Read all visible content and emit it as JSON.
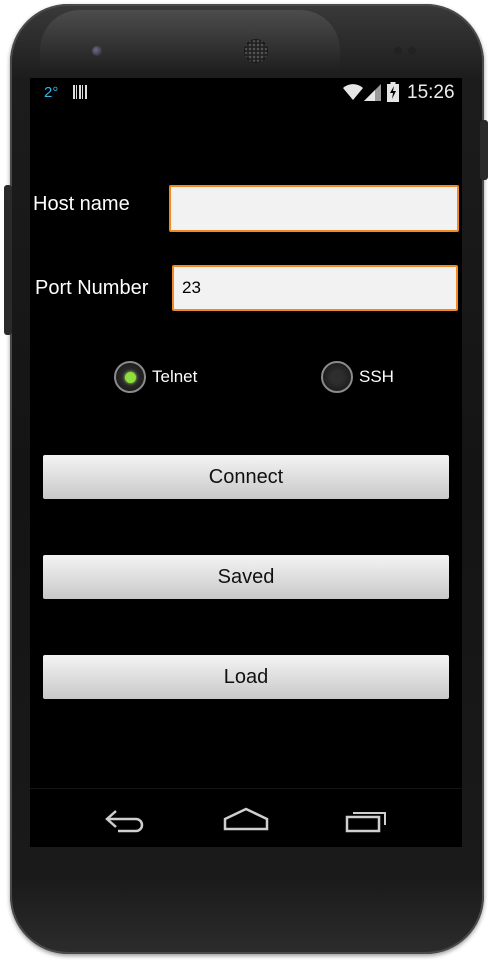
{
  "status_bar": {
    "temperature": "2°",
    "time": "15:26",
    "icons": [
      "barcode-icon",
      "wifi-icon",
      "signal-icon",
      "battery-charging-icon"
    ]
  },
  "form": {
    "host_label": "Host name",
    "host_value": "",
    "port_label": "Port Number",
    "port_value": "23"
  },
  "protocol": {
    "options": [
      {
        "label": "Telnet",
        "selected": true
      },
      {
        "label": "SSH",
        "selected": false
      }
    ]
  },
  "buttons": {
    "connect": "Connect",
    "saved": "Saved",
    "load": "Load"
  },
  "navbar": {
    "icons": [
      "back-icon",
      "home-icon",
      "recent-apps-icon"
    ]
  },
  "colors": {
    "accent_border": "#f08a24",
    "radio_selected": "#8ee03a",
    "status_blue": "#33b5e5"
  }
}
